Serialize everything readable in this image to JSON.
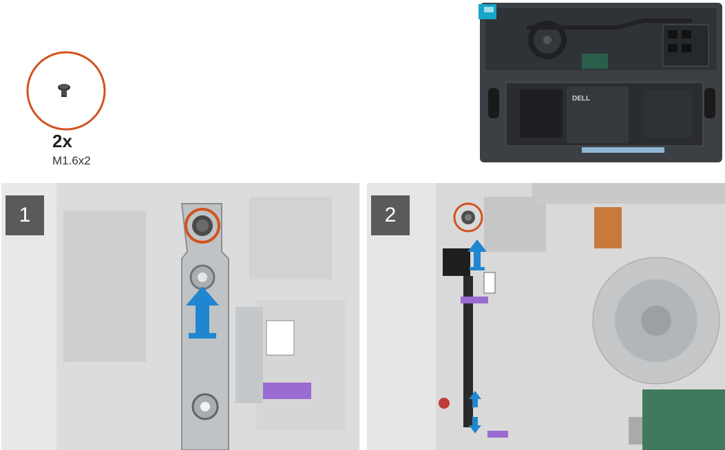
{
  "screws": {
    "quantity": "2x",
    "size": "M1.6x2"
  },
  "steps": [
    {
      "number": "1"
    },
    {
      "number": "2"
    }
  ],
  "colors": {
    "callout_ring": "#d2521f",
    "arrow": "#1f86cf",
    "badge": "#5a5a5a"
  },
  "overview": {
    "battery_logo": "DELL"
  },
  "icons": [
    "screw-icon",
    "up-arrow-icon",
    "double-arrow-icon"
  ]
}
